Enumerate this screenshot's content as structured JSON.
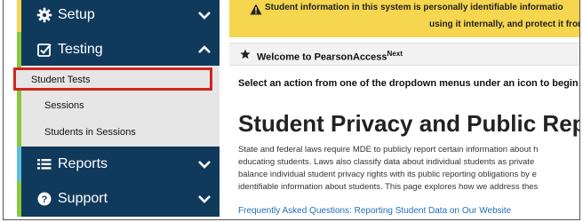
{
  "sidebar": {
    "setup": {
      "label": "Setup",
      "icon": "gear-icon"
    },
    "testing": {
      "label": "Testing",
      "icon": "checkbox-icon",
      "items": [
        "Student Tests",
        "Sessions",
        "Students in Sessions"
      ],
      "selected": "Student Tests"
    },
    "reports": {
      "label": "Reports",
      "icon": "list-icon"
    },
    "support": {
      "label": "Support",
      "icon": "question-icon"
    }
  },
  "alert": {
    "line1": "Student information in this system is personally identifiable informatio",
    "line2": "using it internally, and protect it from e"
  },
  "welcome": {
    "text": "Welcome to PearsonAccess",
    "superscript": "Next"
  },
  "instruction": "Select an action from one of the dropdown menus under an icon to begin a",
  "page_title": "Student Privacy and Public Repor",
  "paragraph": [
    "State and federal laws require MDE to publicly report certain information about h",
    "educating students. Laws also classify data about individual students as private",
    "balance individual student privacy rights with its public reporting obligations by e",
    "identifiable information about students. This page explores how we address thes"
  ],
  "link": "Frequently Asked Questions: Reporting Student Data on Our Website",
  "colors": {
    "nav_bg": "#103a5c",
    "accent_setup": "#f6d54f",
    "accent_testing": "#8cc63f",
    "accent_reports": "#5bc0de",
    "accent_support": "#8cc63f",
    "selection_border": "#d0261d",
    "alert_bg": "#f6d54f",
    "link": "#1f6fb5"
  }
}
